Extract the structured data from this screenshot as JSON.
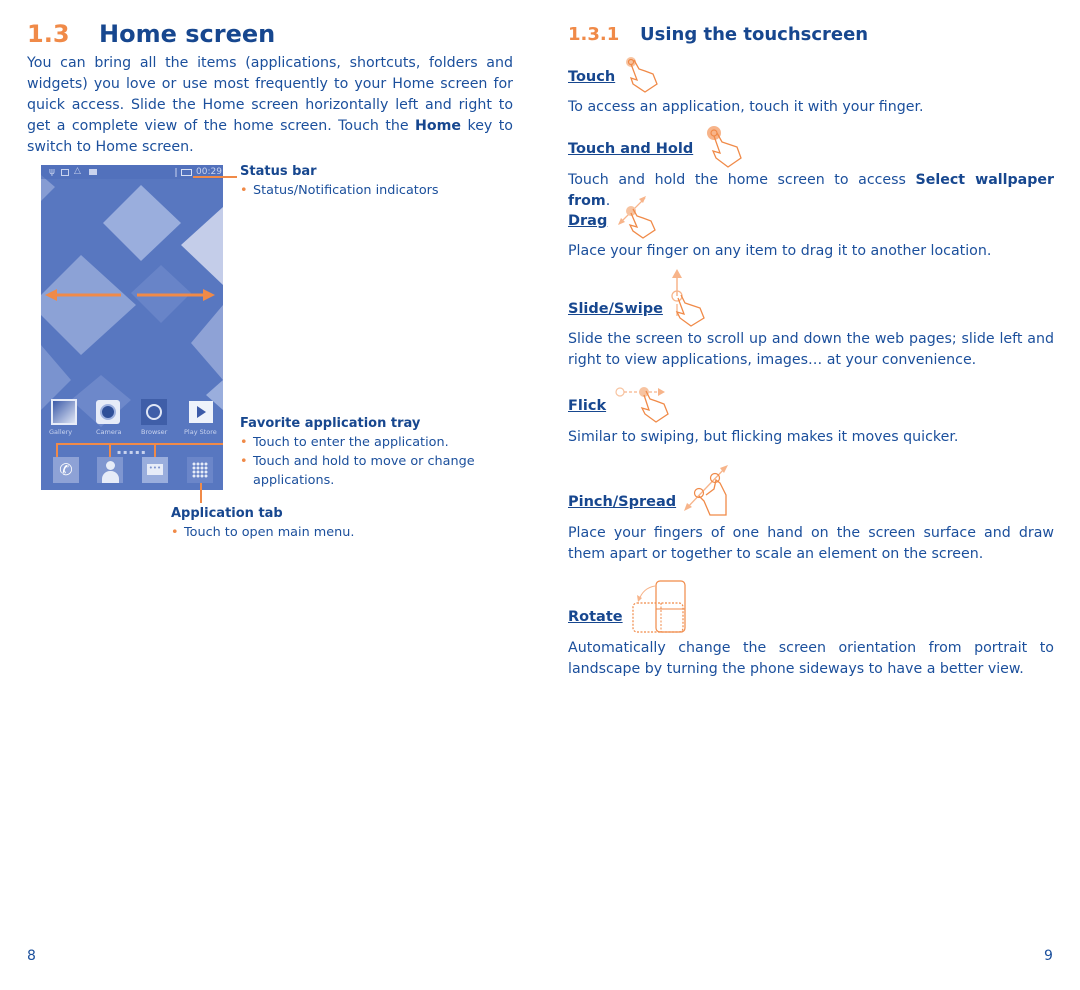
{
  "left_page": {
    "section_number": "1.3",
    "section_title": "Home screen",
    "intro_part1": "You can bring all the items (applications, shortcuts, folders and widgets) you love or use most frequently to your Home screen for quick access. Slide the Home screen horizontally left and right to get a complete view of the home screen. Touch the ",
    "intro_bold": "Home",
    "intro_part2": " key to switch to Home screen.",
    "phone": {
      "status_time": "00:29",
      "apps": [
        "Gallery",
        "Camera",
        "Browser",
        "Play Store"
      ],
      "dock_icons": [
        "phone-icon",
        "contacts-icon",
        "messaging-icon",
        "apps-grid-icon"
      ]
    },
    "annotations": {
      "status_bar": {
        "title": "Status bar",
        "bullets": [
          "Status/Notification indicators"
        ]
      },
      "favorite_tray": {
        "title": "Favorite application tray",
        "bullets": [
          "Touch to enter the application.",
          "Touch and hold to move or change",
          "applications."
        ]
      },
      "application_tab": {
        "title": "Application tab",
        "bullets": [
          "Touch to open main menu."
        ]
      }
    },
    "bullet_glyph": "•",
    "page_number": "8"
  },
  "right_page": {
    "section_number": "1.3.1",
    "section_title": "Using the touchscreen",
    "gestures": [
      {
        "name": "Touch",
        "icon": "tap-hand-icon",
        "description": "To access an application, touch it with your finger."
      },
      {
        "name": "Touch and Hold",
        "icon": "press-hold-hand-icon",
        "description_part1": "Touch and hold the home screen to access ",
        "description_bold": "Select wallpaper from",
        "description_part2": "."
      },
      {
        "name": "Drag",
        "icon": "drag-hand-icon",
        "description": "Place your finger on any item to drag it to another location."
      },
      {
        "name": "Slide/Swipe",
        "icon": "swipe-hand-icon",
        "description": "Slide the screen to scroll up and down the web pages; slide left and right to view applications, images… at your convenience."
      },
      {
        "name": "Flick",
        "icon": "flick-hand-icon",
        "description": "Similar to swiping, but flicking makes it moves quicker."
      },
      {
        "name": "Pinch/Spread",
        "icon": "pinch-spread-hand-icon",
        "description": "Place your fingers of one hand on the screen surface and draw them apart or together to scale an element on the screen."
      },
      {
        "name": "Rotate",
        "icon": "rotate-device-icon",
        "description": "Automatically change the screen orientation from portrait to landscape by turning the phone sideways to have a better view."
      }
    ],
    "page_number": "9"
  },
  "colors": {
    "accent_orange": "#f08a48",
    "text_blue": "#1b4f9c",
    "heading_blue": "#17478f",
    "phone_wallpaper": "#5a79c2"
  }
}
